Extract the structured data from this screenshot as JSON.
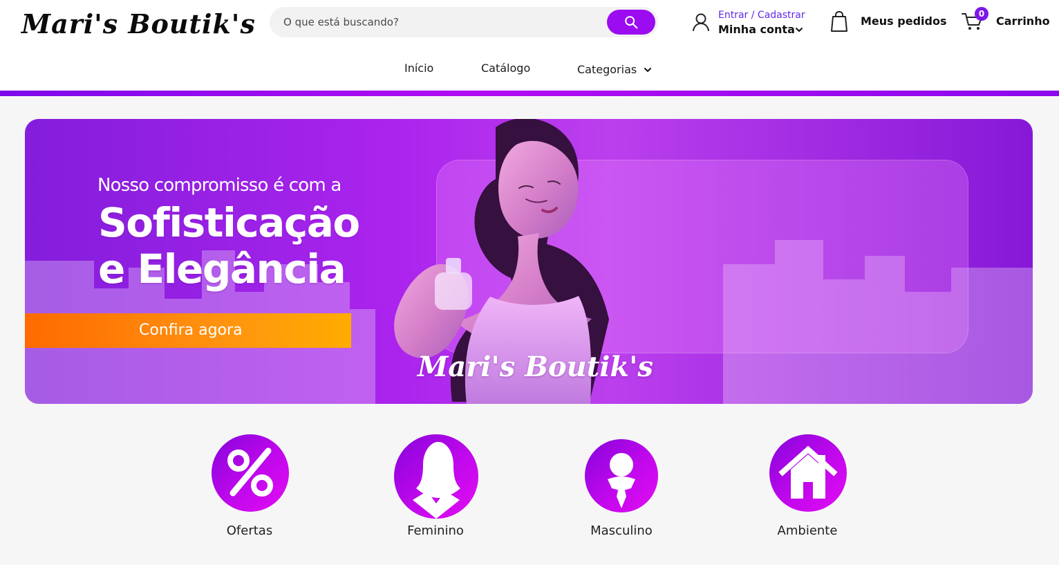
{
  "header": {
    "logo_text": "Mari's Boutik's",
    "search": {
      "placeholder": "O que está buscando?",
      "button_icon": "search-icon"
    },
    "account": {
      "icon": "user-icon",
      "link_text": "Entrar / Cadastrar",
      "label": "Minha conta",
      "caret_icon": "chevron-down-icon"
    },
    "orders": {
      "icon": "shopping-bag-icon",
      "label": "Meus pedidos"
    },
    "cart": {
      "icon": "shopping-cart-icon",
      "badge_count": "0",
      "label": "Carrinho"
    }
  },
  "nav": {
    "items": [
      {
        "label": "Início"
      },
      {
        "label": "Catálogo"
      },
      {
        "label": "Categorias",
        "icon": "chevron-down-icon"
      }
    ]
  },
  "hero": {
    "line_1": "Nosso compromisso é com a",
    "line_2": "Sofisticação",
    "line_3": "e Elegância",
    "cta_label": "Confira agora",
    "brand_text": "Mari's Boutik's"
  },
  "categories": [
    {
      "label": "Ofertas",
      "icon": "percent-icon"
    },
    {
      "label": "Feminino",
      "icon": "female-icon"
    },
    {
      "label": "Masculino",
      "icon": "male-icon"
    },
    {
      "label": "Ambiente",
      "icon": "home-icon"
    }
  ],
  "colors": {
    "brand_purple": "#9b0cf0",
    "header_bar_purple": "#7c09ea",
    "cta_orange": "#ff8a00",
    "account_link_blue": "#6128e8",
    "badge_purple": "#7b17e8",
    "page_background": "#f6f6f6"
  }
}
